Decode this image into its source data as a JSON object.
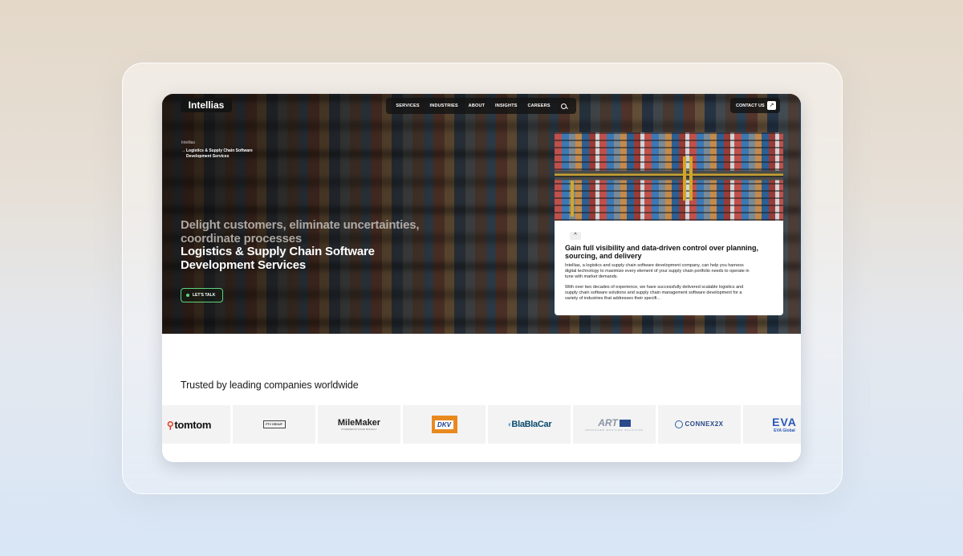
{
  "header": {
    "logo": "Intellias",
    "nav": [
      "SERVICES",
      "INDUSTRIES",
      "ABOUT",
      "INSIGHTS",
      "CAREERS"
    ],
    "contact_label": "CONTACT US"
  },
  "breadcrumb": {
    "root": "Intellias",
    "current": "Logistics & Supply Chain Software Development Services"
  },
  "hero": {
    "tagline": "Delight customers, eliminate uncertainties, coordinate processes",
    "title": "Logistics & Supply Chain Software Development Services",
    "cta_label": "LET'S TALK"
  },
  "card": {
    "chevron": "^",
    "title": "Gain full visibility and data-driven control over planning, sourcing, and delivery",
    "paragraph1": "Intellias, a logistics and supply chain software development company, can help you harness digital technology to maximize every element of your supply chain portfolio needs to operate in tune with market demands.",
    "paragraph2": "With over two decades of experience, we have successfully delivered scalable logistics and supply chain software solutions and supply chain management software development for a variety of industries that addresses their specifi..."
  },
  "trusted": {
    "heading": "Trusted by leading companies worldwide",
    "logos": {
      "tomtom": "tomtom",
      "ptv": "PTV GROUP",
      "milemaker": "MileMaker",
      "milemaker_sub": "POWERED BY RAND MCNALLY",
      "dkv": "DKV",
      "blablacar": "BlaBlaCar",
      "art": "ART",
      "art_sub": "ADVANCED ROUTING SOLUTION",
      "connex": "CONNEX2X",
      "eva": "EVA",
      "eva_sub": "EVA Global"
    }
  },
  "colors": {
    "accent_green": "#5fd37a",
    "page_bg_top": "#e4d8c8",
    "page_bg_bottom": "#d8e6f6"
  }
}
